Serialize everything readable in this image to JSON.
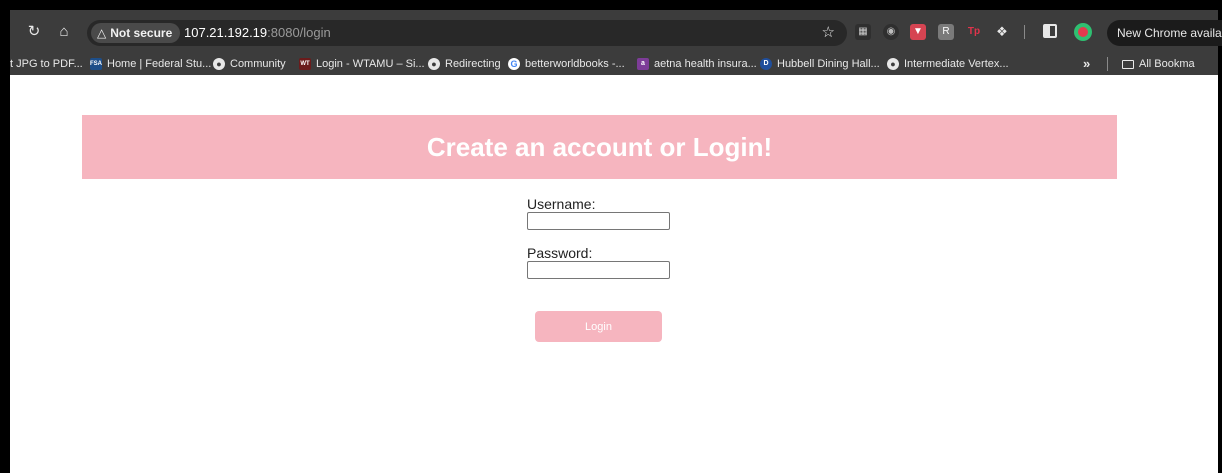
{
  "browser": {
    "security_chip": "Not secure",
    "url_host": "107.21.192.19",
    "url_path": ":8080/login",
    "update_notice": "New Chrome available"
  },
  "bookmarks": [
    {
      "label": "t JPG to PDF...",
      "icon": "none"
    },
    {
      "label": "Home | Federal Stu...",
      "icon": "fsa-icon"
    },
    {
      "label": "Community",
      "icon": "globe-icon"
    },
    {
      "label": "Login - WTAMU – Si...",
      "icon": "wtamu-icon"
    },
    {
      "label": "Redirecting",
      "icon": "globe-icon"
    },
    {
      "label": "betterworldbooks -...",
      "icon": "google-icon"
    },
    {
      "label": "aetna health insura...",
      "icon": "aetna-icon"
    },
    {
      "label": "Hubbell Dining Hall...",
      "icon": "dining-d-icon"
    },
    {
      "label": "Intermediate Vertex...",
      "icon": "globe-icon"
    }
  ],
  "all_bookmarks": "All Bookma",
  "page": {
    "heading": "Create an account or Login!",
    "username_label": "Username:",
    "username_value": "",
    "password_label": "Password:",
    "password_value": "",
    "login_button": "Login"
  },
  "colors": {
    "accent_pink": "#f6b5bf",
    "toolbar": "#3c3c3c"
  }
}
